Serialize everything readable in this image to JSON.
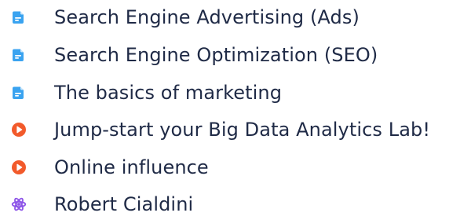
{
  "colors": {
    "text": "#1f2a46",
    "document_icon": "#3aa3f0",
    "video_icon": "#f25a2b",
    "atom_icon": "#8e56e8"
  },
  "items": [
    {
      "label": "Search Engine Advertising (Ads)",
      "icon": "document-icon"
    },
    {
      "label": "Search Engine Optimization (SEO)",
      "icon": "document-icon"
    },
    {
      "label": "The basics of marketing",
      "icon": "document-icon"
    },
    {
      "label": "Jump-start your Big Data Analytics Lab!",
      "icon": "play-icon"
    },
    {
      "label": "Online influence",
      "icon": "play-icon"
    },
    {
      "label": "Robert Cialdini",
      "icon": "atom-icon"
    }
  ]
}
